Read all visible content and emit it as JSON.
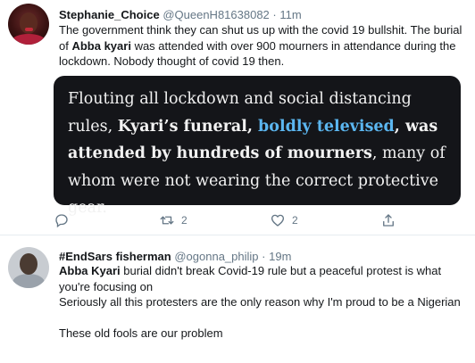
{
  "tweet1": {
    "name": "Stephanie_Choice",
    "handle": "@QueenH81638082",
    "separator": "·",
    "time": "11m",
    "text": {
      "part1": "The government think they can shut us up with the covid 19 bullshit. The burial of ",
      "bold": "Abba kyari",
      "part2": " was attended with over 900 mourners in attendance during the lockdown. Nobody thought of covid 19 then."
    },
    "image_text": {
      "part1": "Flouting all lockdown and social distancing rules, ",
      "bold1": "Kyari’s  funeral, ",
      "accent": "boldly televised",
      "bold2": ", was attended by hundreds of mourners",
      "part2": ", many of whom were not wearing the correct protective gear."
    },
    "actions": {
      "reply_icon": "reply-icon",
      "retweet_icon": "retweet-icon",
      "retweet_count": "2",
      "like_icon": "heart-icon",
      "like_count": "2",
      "share_icon": "share-icon"
    }
  },
  "tweet2": {
    "name": "#EndSars fisherman",
    "handle": "@ogonna_philip",
    "separator": "·",
    "time": "19m",
    "line1_bold": "Abba Kyari",
    "line1_rest": " burial didn't break Covid-19 rule but a peaceful protest is what you're focusing on",
    "line2": "Seriously all this protesters are the only reason why I'm proud to be a Nigerian",
    "line3": "These old fools are our problem"
  },
  "colors": {
    "secondary_text": "#657786",
    "divider": "#e6ecf0",
    "card_background": "#141519",
    "card_accent": "#5bb6f0"
  }
}
